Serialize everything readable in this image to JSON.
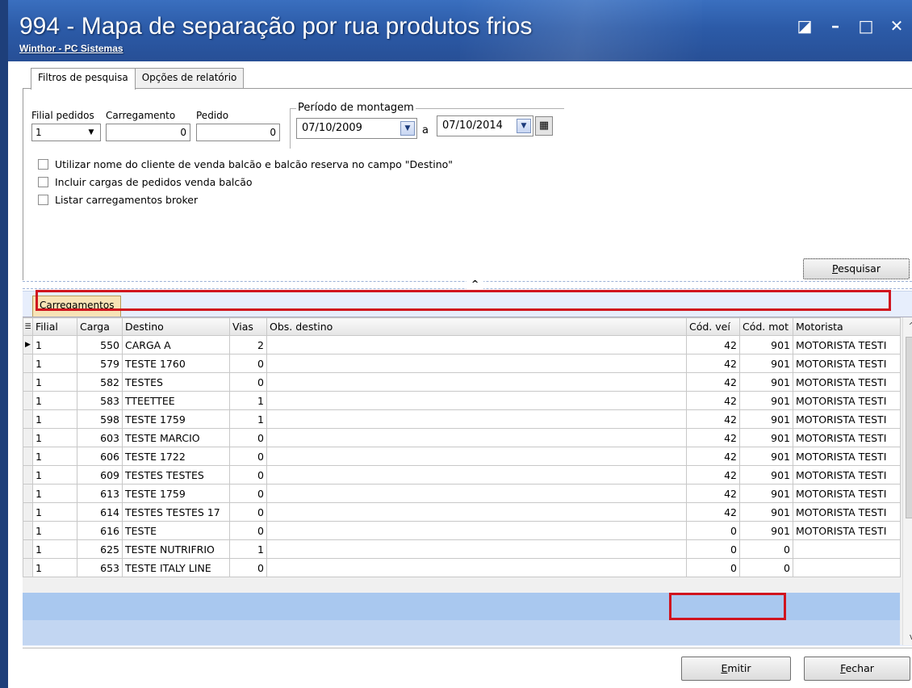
{
  "window": {
    "title": "994 - Mapa de separação por rua produtos frios",
    "subtitle": "Winthor - PC Sistemas"
  },
  "tabs": [
    {
      "label": "Filtros de pesquisa",
      "active": true
    },
    {
      "label": "Opções de relatório",
      "active": false
    }
  ],
  "filters": {
    "filial_label": "Filial pedidos",
    "filial_value": "1",
    "carregamento_label": "Carregamento",
    "carregamento_value": "0",
    "pedido_label": "Pedido",
    "pedido_value": "0",
    "periodo_label": "Período de montagem",
    "date_from": "07/10/2009",
    "date_sep": "a",
    "date_to": "07/10/2014"
  },
  "checkboxes": [
    {
      "label": "Utilizar nome do cliente de venda balcão e balcão reserva no campo \"Destino\"",
      "checked": false
    },
    {
      "label": "Incluir cargas de pedidos venda balcão",
      "checked": false
    },
    {
      "label": "Listar carregamentos broker",
      "checked": false
    }
  ],
  "buttons": {
    "pesquisar_u": "P",
    "pesquisar_rest": "esquisar",
    "emitir_u": "E",
    "emitir_rest": "mitir",
    "fechar_u": "F",
    "fechar_rest": "echar"
  },
  "grid": {
    "tab_label": "Carregamentos",
    "columns": [
      "Filial",
      "Carga",
      "Destino",
      "Vias",
      "Obs. destino",
      "Cód. veí",
      "Cód. mot",
      "Motorista"
    ],
    "rows": [
      {
        "filial": "1",
        "carga": "550",
        "destino": "CARGA A",
        "vias": "2",
        "obs": "",
        "cod_vei": "42",
        "cod_mot": "901",
        "motorista": "MOTORISTA TESTI"
      },
      {
        "filial": "1",
        "carga": "579",
        "destino": "TESTE 1760",
        "vias": "0",
        "obs": "",
        "cod_vei": "42",
        "cod_mot": "901",
        "motorista": "MOTORISTA TESTI"
      },
      {
        "filial": "1",
        "carga": "582",
        "destino": "TESTES",
        "vias": "0",
        "obs": "",
        "cod_vei": "42",
        "cod_mot": "901",
        "motorista": "MOTORISTA TESTI"
      },
      {
        "filial": "1",
        "carga": "583",
        "destino": "TTEETTEE",
        "vias": "1",
        "obs": "",
        "cod_vei": "42",
        "cod_mot": "901",
        "motorista": "MOTORISTA TESTI"
      },
      {
        "filial": "1",
        "carga": "598",
        "destino": "TESTE 1759",
        "vias": "1",
        "obs": "",
        "cod_vei": "42",
        "cod_mot": "901",
        "motorista": "MOTORISTA TESTI"
      },
      {
        "filial": "1",
        "carga": "603",
        "destino": "TESTE MARCIO",
        "vias": "0",
        "obs": "",
        "cod_vei": "42",
        "cod_mot": "901",
        "motorista": "MOTORISTA TESTI"
      },
      {
        "filial": "1",
        "carga": "606",
        "destino": "TESTE 1722",
        "vias": "0",
        "obs": "",
        "cod_vei": "42",
        "cod_mot": "901",
        "motorista": "MOTORISTA TESTI"
      },
      {
        "filial": "1",
        "carga": "609",
        "destino": "TESTES TESTES",
        "vias": "0",
        "obs": "",
        "cod_vei": "42",
        "cod_mot": "901",
        "motorista": "MOTORISTA TESTI"
      },
      {
        "filial": "1",
        "carga": "613",
        "destino": "TESTE 1759",
        "vias": "0",
        "obs": "",
        "cod_vei": "42",
        "cod_mot": "901",
        "motorista": "MOTORISTA TESTI"
      },
      {
        "filial": "1",
        "carga": "614",
        "destino": "TESTES TESTES 17",
        "vias": "0",
        "obs": "",
        "cod_vei": "42",
        "cod_mot": "901",
        "motorista": "MOTORISTA TESTI"
      },
      {
        "filial": "1",
        "carga": "616",
        "destino": "TESTE",
        "vias": "0",
        "obs": "",
        "cod_vei": "0",
        "cod_mot": "901",
        "motorista": "MOTORISTA TESTI"
      },
      {
        "filial": "1",
        "carga": "625",
        "destino": "TESTE NUTRIFRIO",
        "vias": "1",
        "obs": "",
        "cod_vei": "0",
        "cod_mot": "0",
        "motorista": ""
      },
      {
        "filial": "1",
        "carga": "653",
        "destino": "TESTE ITALY LINE",
        "vias": "0",
        "obs": "",
        "cod_vei": "0",
        "cod_mot": "0",
        "motorista": ""
      }
    ]
  },
  "colors": {
    "titlebar": "#2c5ba8",
    "highlight": "#d0141e",
    "grid_tab": "#f7e3b6"
  }
}
